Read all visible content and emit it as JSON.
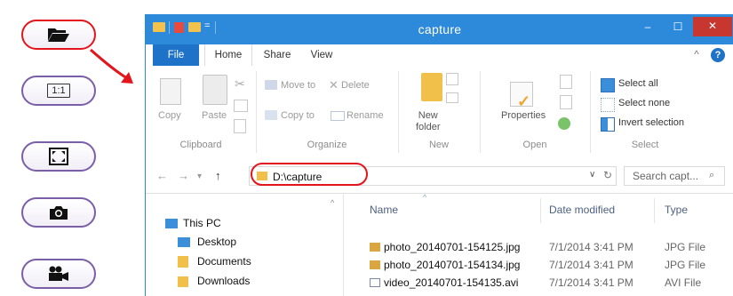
{
  "toolbar": {
    "buttons": [
      {
        "name": "open-folder",
        "icon": "folder-open-icon",
        "highlighted": true
      },
      {
        "name": "actual-size",
        "icon": "one-to-one-icon",
        "label": "1:1"
      },
      {
        "name": "fullscreen",
        "icon": "fullscreen-icon"
      },
      {
        "name": "snapshot",
        "icon": "camera-icon"
      },
      {
        "name": "record",
        "icon": "video-camera-icon"
      }
    ],
    "highlight_color": "#e3141b"
  },
  "window": {
    "title": "capture",
    "minimize": "–",
    "maximize": "☐",
    "close": "✕",
    "accent": "#2d89d9"
  },
  "ribbon_tabs": [
    "File",
    "Home",
    "Share",
    "View"
  ],
  "ribbon": {
    "clipboard": {
      "label": "Clipboard",
      "copy": "Copy",
      "paste": "Paste"
    },
    "organize": {
      "label": "Organize",
      "move_to": "Move to",
      "copy_to": "Copy to",
      "delete": "Delete",
      "rename": "Rename"
    },
    "new": {
      "label": "New",
      "new_folder": "New\nfolder"
    },
    "open": {
      "label": "Open",
      "properties": "Properties"
    },
    "select": {
      "label": "Select",
      "select_all": "Select all",
      "select_none": "Select none",
      "invert": "Invert selection"
    }
  },
  "address": {
    "path": "D:\\capture",
    "search_placeholder": "Search capt...",
    "back": "←",
    "forward": "→",
    "up": "↑"
  },
  "nav_pane": {
    "items": [
      "This PC",
      "Desktop",
      "Documents",
      "Downloads"
    ]
  },
  "file_list": {
    "columns": [
      "Name",
      "Date modified",
      "Type"
    ],
    "rows": [
      {
        "name": "photo_20140701-154125.jpg",
        "date": "7/1/2014 3:41 PM",
        "type": "JPG File",
        "icon": "jpg-file-icon"
      },
      {
        "name": "photo_20140701-154134.jpg",
        "date": "7/1/2014 3:41 PM",
        "type": "JPG File",
        "icon": "jpg-file-icon"
      },
      {
        "name": "video_20140701-154135.avi",
        "date": "7/1/2014 3:41 PM",
        "type": "AVI File",
        "icon": "avi-file-icon"
      }
    ]
  }
}
